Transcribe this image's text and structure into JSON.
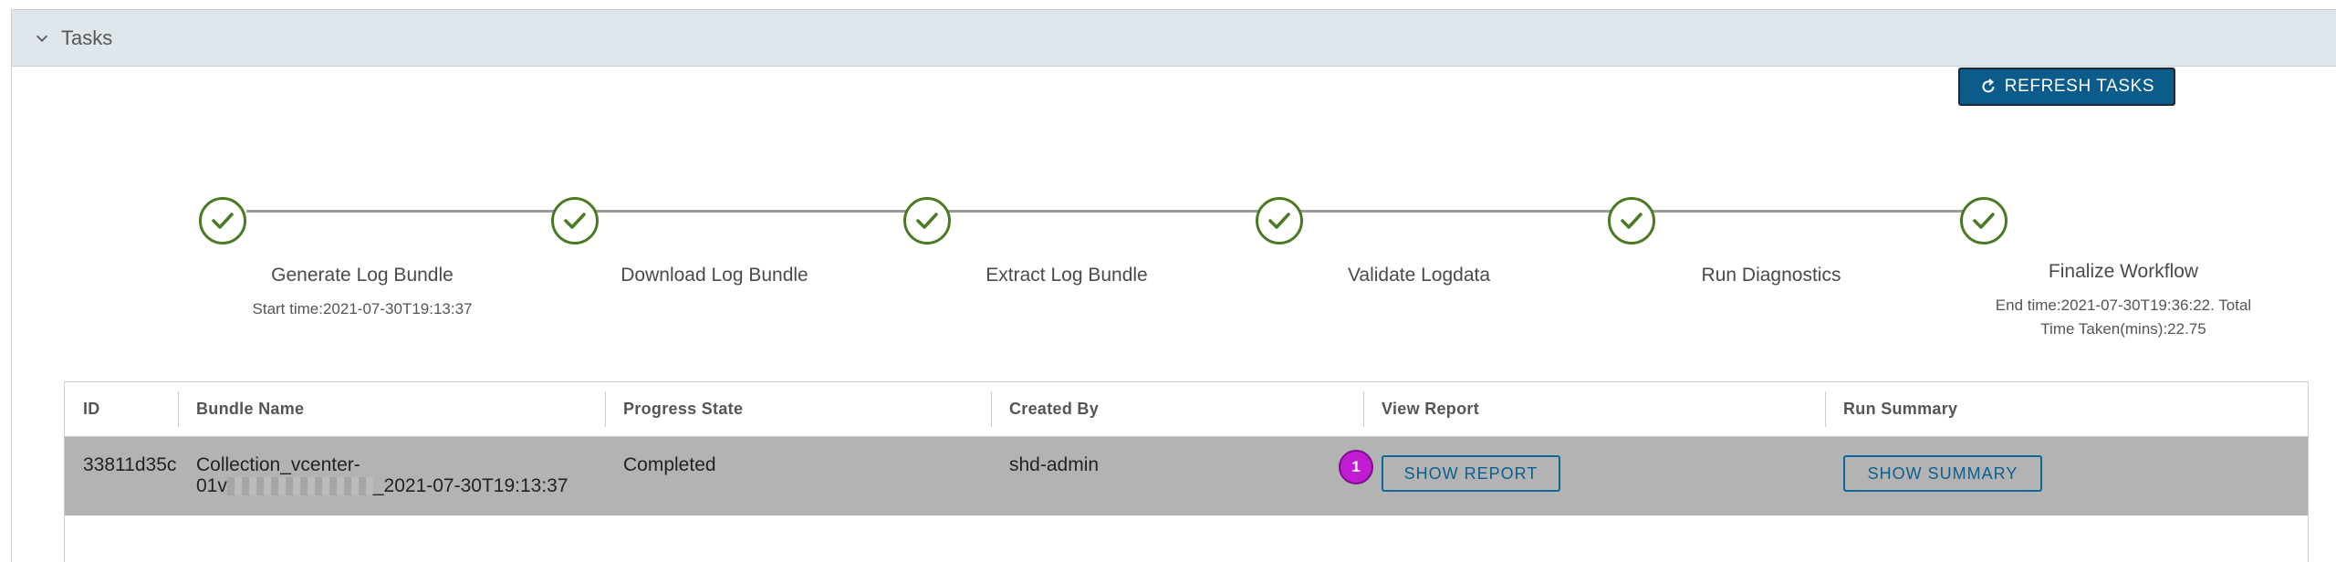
{
  "panel": {
    "title": "Tasks",
    "collapse_icon": "chevron-down-icon"
  },
  "toolbar": {
    "refresh_label": "REFRESH TASKS",
    "refresh_icon": "refresh-icon"
  },
  "steps": [
    {
      "label": "Generate Log Bundle",
      "detail": "Start time:2021-07-30T19:13:37",
      "status": "complete"
    },
    {
      "label": "Download Log Bundle",
      "detail": "",
      "status": "complete"
    },
    {
      "label": "Extract Log Bundle",
      "detail": "",
      "status": "complete"
    },
    {
      "label": "Validate Logdata",
      "detail": "",
      "status": "complete"
    },
    {
      "label": "Run Diagnostics",
      "detail": "",
      "status": "complete"
    },
    {
      "label": "Finalize Workflow",
      "detail_line1": "End time:2021-07-30T19:36:22. Total",
      "detail_line2": "Time Taken(mins):22.75",
      "status": "complete"
    }
  ],
  "table": {
    "columns": [
      "ID",
      "Bundle Name",
      "Progress State",
      "Created By",
      "View Report",
      "Run Summary"
    ],
    "rows": [
      {
        "id": "33811d35c",
        "bundle_line1": "Collection_vcenter-",
        "bundle_prefix": "01v",
        "bundle_suffix": "_2021-07-30T19:13:37",
        "progress": "Completed",
        "created_by": "shd-admin",
        "report_button": "SHOW REPORT",
        "summary_button": "SHOW SUMMARY",
        "badge": "1"
      }
    ]
  },
  "colors": {
    "step_complete": "#4a7a22",
    "primary_button": "#0b5c8a",
    "badge": "#c21bd4",
    "row_selected": "#b3b3b3"
  }
}
